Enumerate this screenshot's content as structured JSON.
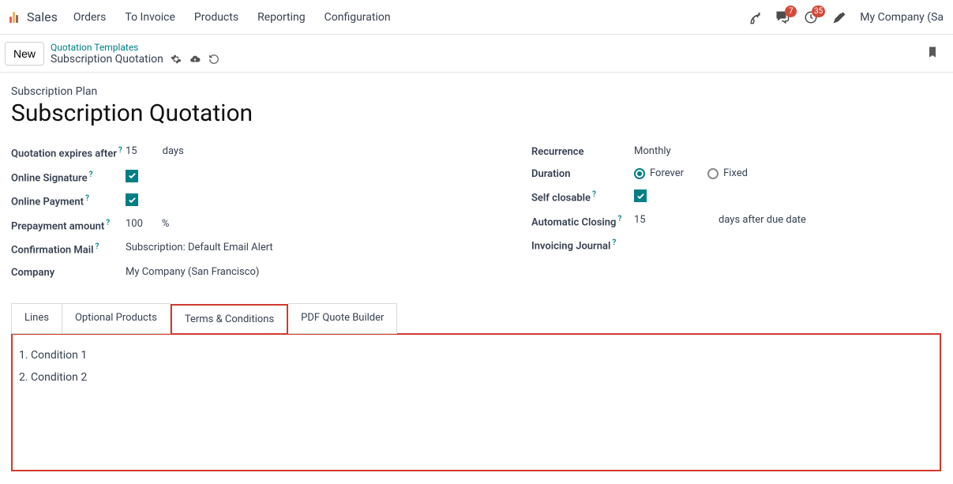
{
  "nav": {
    "brand": "Sales",
    "items": [
      "Orders",
      "To Invoice",
      "Products",
      "Reporting",
      "Configuration"
    ],
    "badges": {
      "messages": "7",
      "activities": "35"
    },
    "company": "My Company (Sa"
  },
  "controlbar": {
    "new_label": "New",
    "breadcrumb_parent": "Quotation Templates",
    "breadcrumb_current": "Subscription Quotation"
  },
  "header": {
    "plan_label": "Subscription Plan",
    "title": "Subscription Quotation"
  },
  "labels": {
    "quotation_expires": "Quotation expires after",
    "online_signature": "Online Signature",
    "online_payment": "Online Payment",
    "prepayment_amount": "Prepayment amount",
    "confirmation_mail": "Confirmation Mail",
    "company": "Company",
    "recurrence": "Recurrence",
    "duration": "Duration",
    "self_closable": "Self closable",
    "automatic_closing": "Automatic Closing",
    "invoicing_journal": "Invoicing Journal",
    "help": "?"
  },
  "values": {
    "expires_value": "15",
    "expires_unit": "days",
    "prepayment_value": "100",
    "prepayment_unit": "%",
    "confirmation_mail": "Subscription: Default Email Alert",
    "company": "My Company (San Francisco)",
    "recurrence": "Monthly",
    "duration_forever": "Forever",
    "duration_fixed": "Fixed",
    "auto_close_value": "15",
    "auto_close_suffix": "days after due date"
  },
  "tabs": [
    "Lines",
    "Optional Products",
    "Terms & Conditions",
    "PDF Quote Builder"
  ],
  "terms": [
    "1. Condition 1",
    "2. Condition 2"
  ]
}
